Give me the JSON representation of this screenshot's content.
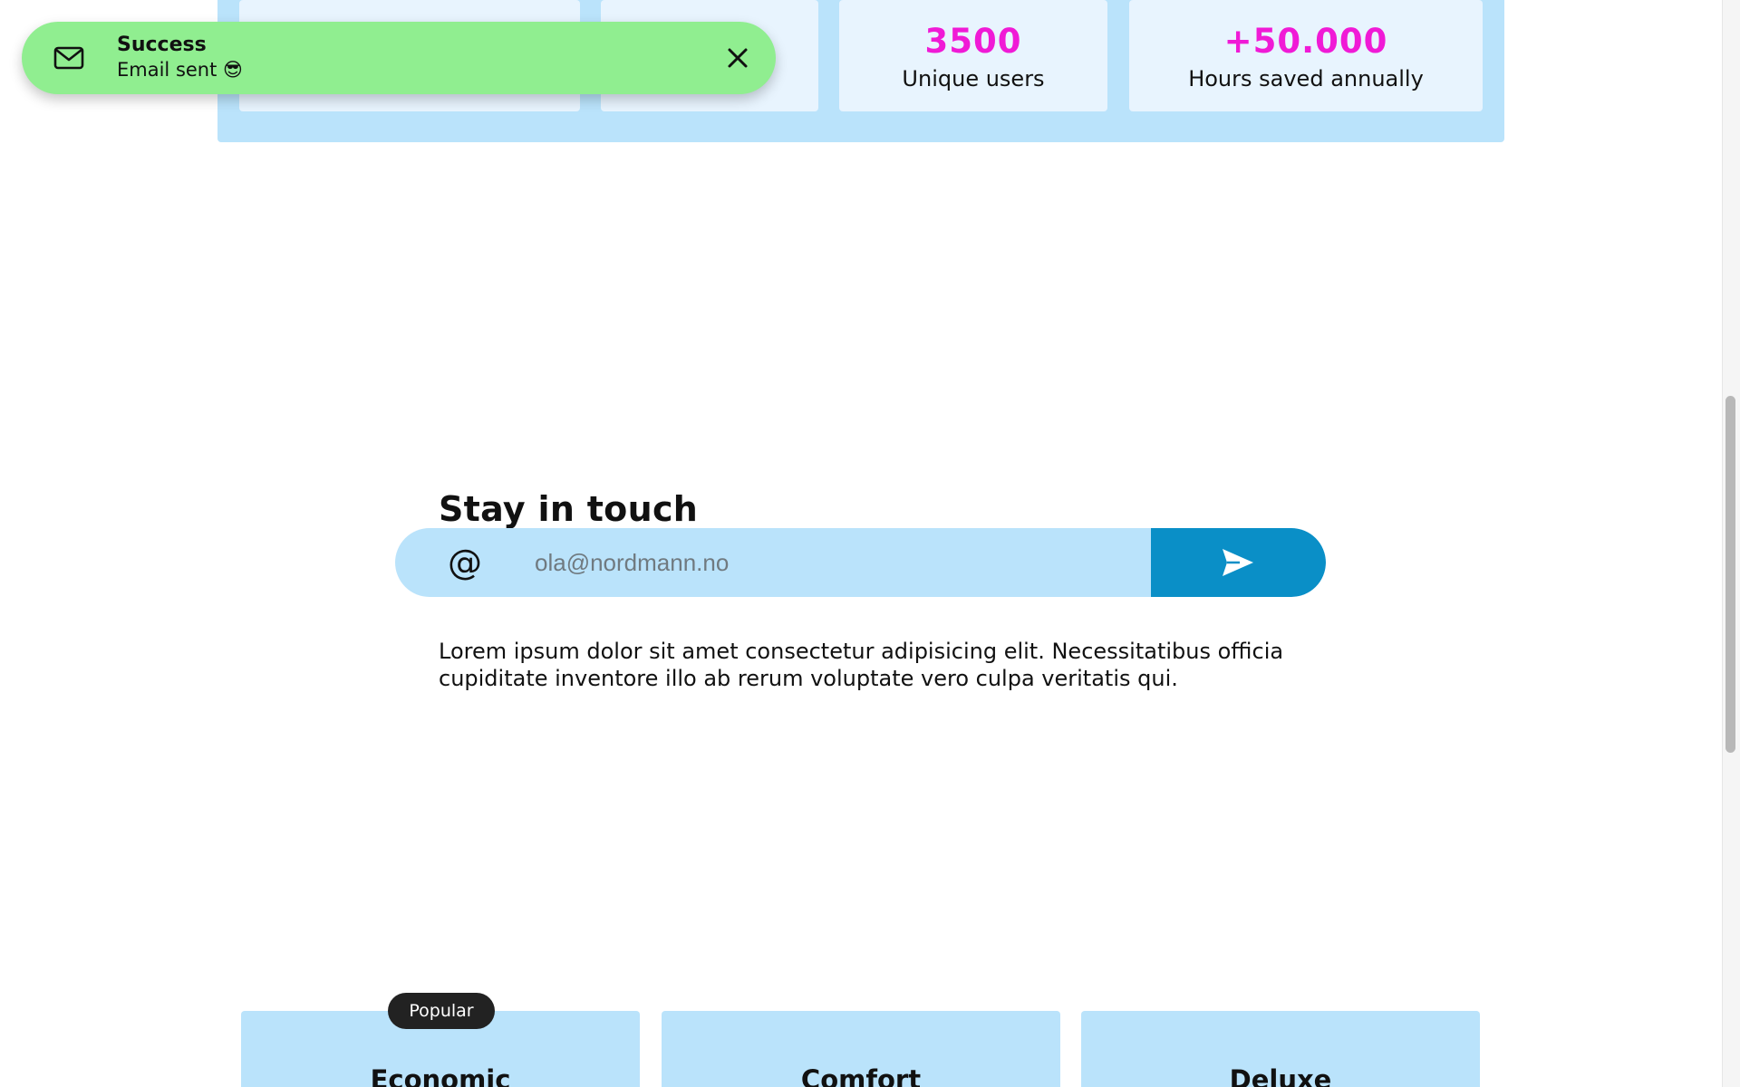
{
  "stats": [
    {
      "value": "",
      "label": ""
    },
    {
      "value": "",
      "label": ""
    },
    {
      "value": "3500",
      "label": "Unique users"
    },
    {
      "value": "+50.000",
      "label": "Hours saved annually"
    }
  ],
  "toast": {
    "title": "Success",
    "message": "Email sent 😎",
    "icon": "mail-icon",
    "close_icon": "close-icon",
    "color": "#90ee90"
  },
  "stay_in_touch": {
    "title": "Stay in touch",
    "at_symbol": "@",
    "email_placeholder": "ola@nordmann.no",
    "send_icon": "send-icon",
    "description": "Lorem ipsum dolor sit amet consectetur adipisicing elit. Necessitatibus officia cupiditate inventore illo ab rerum voluptate vero culpa veritatis qui."
  },
  "pricing": {
    "badge": "Popular",
    "plans": [
      {
        "name": "Economic"
      },
      {
        "name": "Comfort"
      },
      {
        "name": "Deluxe"
      }
    ]
  },
  "colors": {
    "accent": "#f01ad6",
    "panel": "#bae3fb",
    "send_button": "#0a8fc7"
  }
}
